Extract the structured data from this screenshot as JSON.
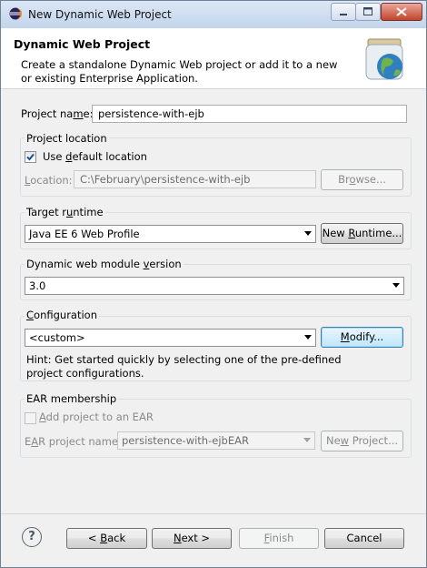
{
  "window": {
    "title": "New Dynamic Web Project"
  },
  "header": {
    "title": "Dynamic Web Project",
    "description": "Create a standalone Dynamic Web project or add it to a new or existing Enterprise Application."
  },
  "project_name": {
    "label_pre": "Project na",
    "label_mn": "m",
    "label_post": "e:",
    "value": "persistence-with-ejb"
  },
  "location_group": {
    "title": "Project location",
    "use_default": {
      "pre": "Use ",
      "mn": "d",
      "post": "efault location",
      "checked": true
    },
    "location_label": {
      "mn": "L",
      "post": "ocation:"
    },
    "location_value": "C:\\February\\persistence-with-ejb",
    "browse": {
      "pre": "Br",
      "mn": "o",
      "post": "wse..."
    }
  },
  "runtime_group": {
    "title": {
      "pre": "Target r",
      "mn": "u",
      "post": "ntime"
    },
    "selected": "Java EE 6 Web Profile",
    "new_runtime": {
      "pre": "New ",
      "mn": "R",
      "post": "untime..."
    }
  },
  "module_group": {
    "title": {
      "pre": "Dynamic web module ",
      "mn": "v",
      "post": "ersion"
    },
    "selected": "3.0"
  },
  "config_group": {
    "title": {
      "pre": "",
      "mn": "C",
      "post": "onfiguration"
    },
    "selected": "<custom>",
    "modify": {
      "pre": "",
      "mn": "M",
      "post": "odify..."
    },
    "hint": "Hint: Get started quickly by selecting one of the pre-defined project configurations."
  },
  "ear_group": {
    "title": "EAR membership",
    "add_to_ear": {
      "pre": "",
      "mn": "A",
      "post": "dd project to an EAR",
      "checked": false
    },
    "ear_name_label": {
      "pre": "E",
      "mn": "A",
      "post": "R project name:"
    },
    "ear_name_value": "persistence-with-ejbEAR",
    "new_project": {
      "pre": "Ne",
      "mn": "w",
      "post": " Project..."
    }
  },
  "footer": {
    "help_glyph": "?",
    "back": {
      "pre": "< ",
      "mn": "B",
      "post": "ack"
    },
    "next": {
      "pre": "",
      "mn": "N",
      "post": "ext >"
    },
    "finish": {
      "pre": "",
      "mn": "F",
      "post": "inish"
    },
    "cancel": "Cancel"
  },
  "colors": {
    "title_bar": "#c3d5ec",
    "focus_border": "#3c7fb1",
    "window_bg": "#f0f0f0"
  }
}
